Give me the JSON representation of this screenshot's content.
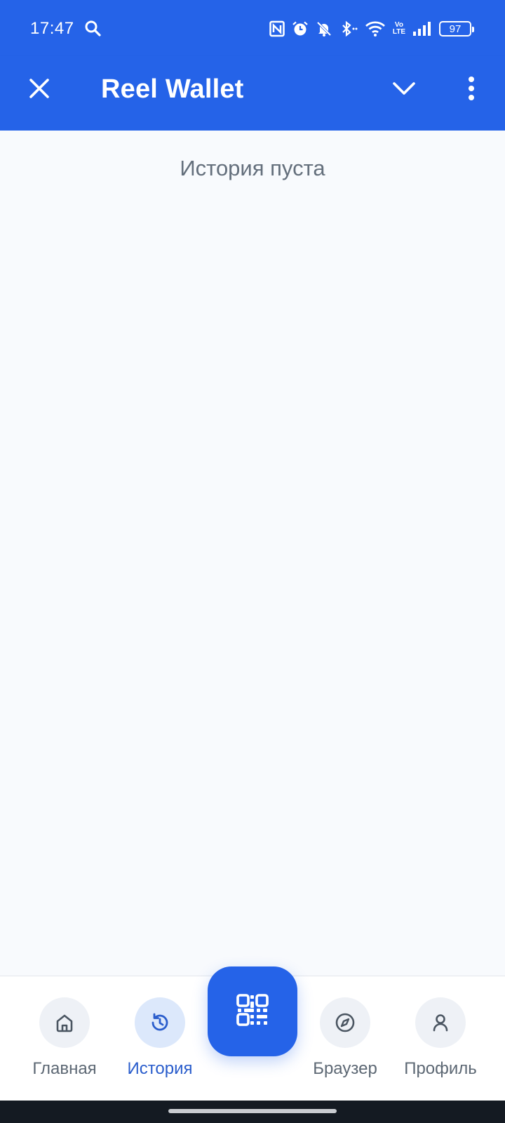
{
  "status_bar": {
    "time": "17:47",
    "battery_level": "97",
    "network_badge_top": "Vo",
    "network_badge_bottom": "LTE",
    "icons": [
      "search-icon",
      "nfc-icon",
      "alarm-icon",
      "bell-off-icon",
      "bluetooth-icon",
      "wifi-icon",
      "volte-icon",
      "signal-icon",
      "battery-icon"
    ]
  },
  "app_bar": {
    "title": "Reel Wallet",
    "icons": [
      "close-icon",
      "chevron-down-icon",
      "more-vertical-icon"
    ]
  },
  "main": {
    "empty_message": "История пуста"
  },
  "bottom_nav": {
    "items": [
      {
        "label": "Главная",
        "icon": "home-icon",
        "active": false
      },
      {
        "label": "История",
        "icon": "history-icon",
        "active": true
      },
      {
        "label": "Браузер",
        "icon": "compass-icon",
        "active": false
      },
      {
        "label": "Профиль",
        "icon": "user-icon",
        "active": false
      }
    ],
    "center_button_icon": "qr-scan-icon"
  },
  "colors": {
    "primary": "#2563e8",
    "background": "#f8fafd",
    "active_label": "#2a5dcc",
    "inactive_label": "#5d6874"
  }
}
